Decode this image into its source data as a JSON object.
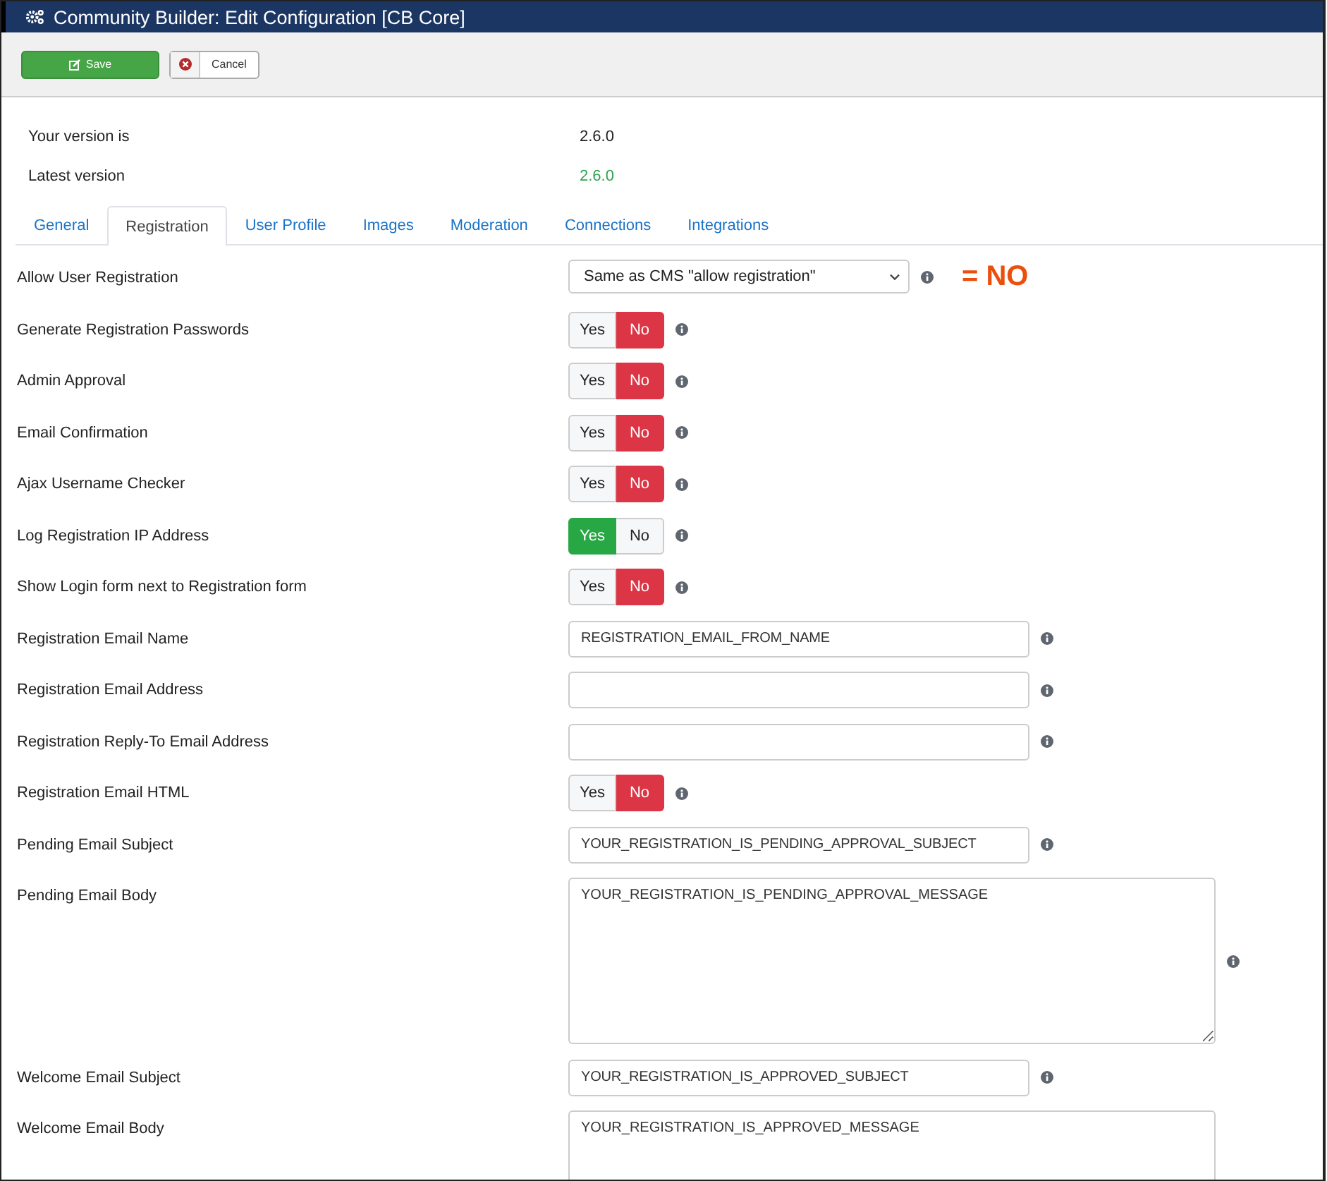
{
  "window": {
    "title": "Community Builder: Edit Configuration [CB Core]"
  },
  "toolbar": {
    "save": "Save",
    "cancel": "Cancel"
  },
  "versions": [
    {
      "label": "Your version is",
      "value": "2.6.0",
      "current": false
    },
    {
      "label": "Latest version",
      "value": "2.6.0",
      "current": true
    }
  ],
  "tabs": [
    {
      "label": "General",
      "selected": false
    },
    {
      "label": "Registration",
      "selected": true
    },
    {
      "label": "User Profile",
      "selected": false
    },
    {
      "label": "Images",
      "selected": false
    },
    {
      "label": "Moderation",
      "selected": false
    },
    {
      "label": "Connections",
      "selected": false
    },
    {
      "label": "Integrations",
      "selected": false
    }
  ],
  "fields": [
    {
      "label": "Allow User Registration",
      "kind": "select",
      "value": "Same as CMS \"allow registration\"",
      "annotation": "= NO"
    },
    {
      "label": "Generate Registration Passwords",
      "kind": "toggle",
      "options": [
        {
          "label": "Yes",
          "selected": false
        },
        {
          "label": "No",
          "selected": true
        }
      ]
    },
    {
      "label": "Admin Approval",
      "kind": "toggle",
      "options": [
        {
          "label": "Yes",
          "selected": false
        },
        {
          "label": "No",
          "selected": true
        }
      ]
    },
    {
      "label": "Email Confirmation",
      "kind": "toggle",
      "options": [
        {
          "label": "Yes",
          "selected": false
        },
        {
          "label": "No",
          "selected": true
        }
      ]
    },
    {
      "label": "Ajax Username Checker",
      "kind": "toggle",
      "options": [
        {
          "label": "Yes",
          "selected": false
        },
        {
          "label": "No",
          "selected": true
        }
      ]
    },
    {
      "label": "Log Registration IP Address",
      "kind": "toggle",
      "options": [
        {
          "label": "Yes",
          "selected": true
        },
        {
          "label": "No",
          "selected": false
        }
      ]
    },
    {
      "label": "Show Login form next to Registration form",
      "kind": "toggle",
      "options": [
        {
          "label": "Yes",
          "selected": false
        },
        {
          "label": "No",
          "selected": true
        }
      ]
    },
    {
      "label": "Registration Email Name",
      "kind": "text",
      "value": "REGISTRATION_EMAIL_FROM_NAME"
    },
    {
      "label": "Registration Email Address",
      "kind": "text"
    },
    {
      "label": "Registration Reply-To Email Address",
      "kind": "text"
    },
    {
      "label": "Registration Email HTML",
      "kind": "toggle",
      "options": [
        {
          "label": "Yes",
          "selected": false
        },
        {
          "label": "No",
          "selected": true
        }
      ]
    },
    {
      "label": "Pending Email Subject",
      "kind": "text",
      "value": "YOUR_REGISTRATION_IS_PENDING_APPROVAL_SUBJECT"
    },
    {
      "label": "Pending Email Body",
      "kind": "textarea",
      "value": "YOUR_REGISTRATION_IS_PENDING_APPROVAL_MESSAGE"
    },
    {
      "label": "Welcome Email Subject",
      "kind": "text",
      "value": "YOUR_REGISTRATION_IS_APPROVED_SUBJECT"
    },
    {
      "label": "Welcome Email Body",
      "kind": "textarea",
      "value": "YOUR_REGISTRATION_IS_APPROVED_MESSAGE",
      "info": false
    }
  ]
}
